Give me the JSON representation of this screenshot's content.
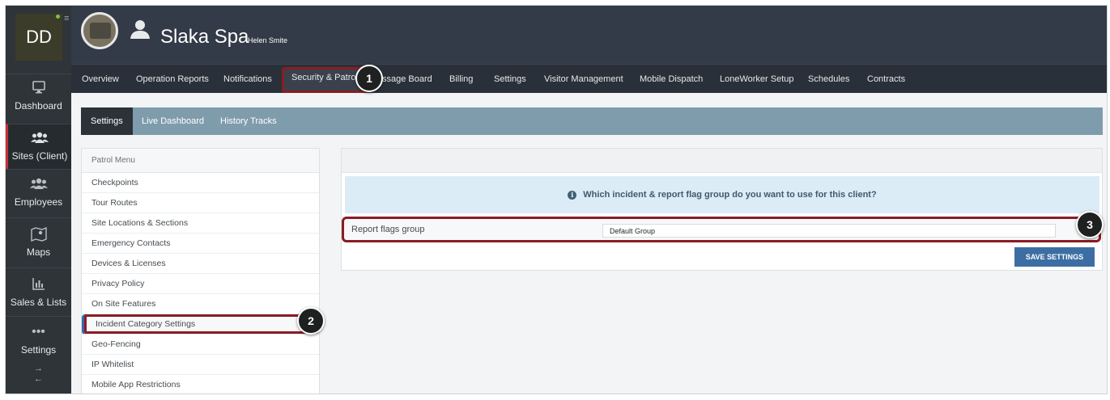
{
  "sidebar": {
    "logo": "DD",
    "items": [
      {
        "label": "Dashboard",
        "icon": "monitor-icon"
      },
      {
        "label": "Sites (Client)",
        "icon": "group-icon"
      },
      {
        "label": "Employees",
        "icon": "group-icon"
      },
      {
        "label": "Maps",
        "icon": "map-pin-icon"
      },
      {
        "label": "Sales & Lists",
        "icon": "bar-chart-icon"
      },
      {
        "label": "Settings",
        "icon": "dots-icon"
      }
    ],
    "arrow_right": "→",
    "arrow_left": "←"
  },
  "header": {
    "title": "Slaka Spa",
    "subtitle": "Helen Smite"
  },
  "tabs": [
    "Overview",
    "Operation Reports",
    "Notifications",
    "Security & Patrol",
    "Message Board",
    "Billing",
    "Settings",
    "Visitor Management",
    "Mobile Dispatch",
    "LoneWorker Setup",
    "Schedules",
    "Contracts"
  ],
  "tab_visible_labels": [
    "Overview",
    "Operation Reports",
    "Notifications",
    "Security & Patrol",
    "ssage Board",
    "Billing",
    "Settings",
    "Visitor Management",
    "Mobile Dispatch",
    "LoneWorker Setup",
    "Schedules",
    "Contracts"
  ],
  "subtabs": [
    "Settings",
    "Live Dashboard",
    "History Tracks"
  ],
  "patrol_menu": {
    "title": "Patrol Menu",
    "items": [
      "Checkpoints",
      "Tour Routes",
      "Site Locations & Sections",
      "Emergency Contacts",
      "Devices & Licenses",
      "Privacy Policy",
      "On Site Features",
      "Incident Category Settings",
      "Geo-Fencing",
      "IP Whitelist",
      "Mobile App Restrictions"
    ]
  },
  "panel": {
    "info": "Which incident & report flag group do you want to use for this client?",
    "field_label": "Report flags group",
    "field_value": "Default Group",
    "save_label": "SAVE SETTINGS"
  },
  "callouts": [
    "1",
    "2",
    "3"
  ],
  "colors": {
    "sidebar_bg": "#2f3439",
    "topbar_bg": "#333a48",
    "subtab_bar": "#7f9cac",
    "highlight": "#8a1c24",
    "save_button": "#3c6ea3",
    "info_bg": "#dcecf6"
  }
}
